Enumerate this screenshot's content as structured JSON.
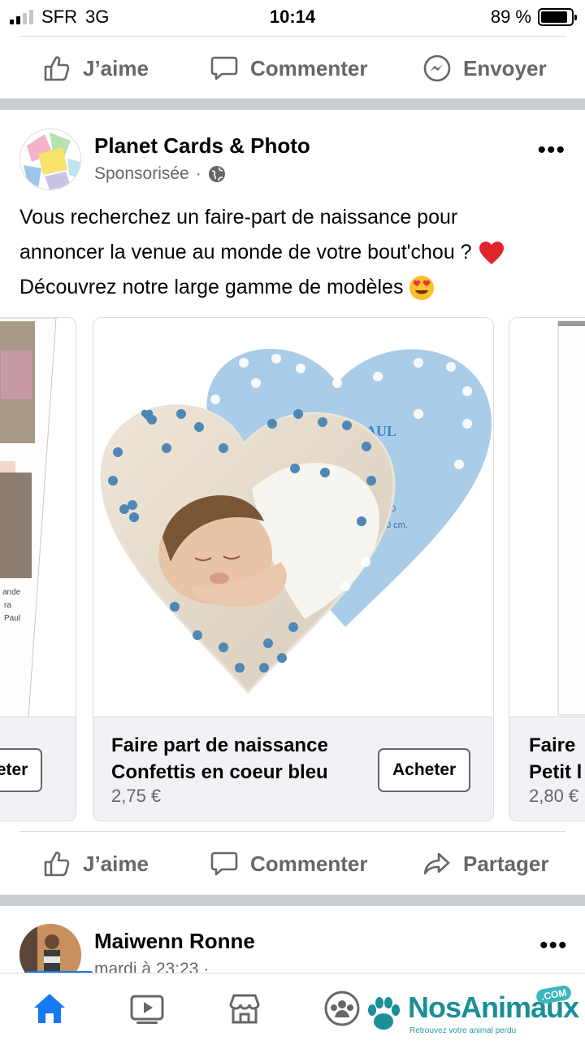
{
  "status_bar": {
    "carrier": "SFR",
    "network": "3G",
    "time": "10:14",
    "battery": "89 %",
    "battery_level": 0.89
  },
  "top_actions": {
    "like": "J’aime",
    "comment": "Commenter",
    "send": "Envoyer"
  },
  "post": {
    "page_name": "Planet Cards & Photo",
    "sponsored": "Sponsorisée",
    "more": "•••",
    "text_lines": [
      "Vous recherchez un faire-part de naissance pour",
      "annoncer la venue au monde de votre bout'chou ?",
      "Découvrez notre large gamme de modèles"
    ],
    "carousel": [
      {
        "title": "",
        "price": "",
        "button": "heter"
      },
      {
        "title_line1": "Faire part de naissance",
        "title_line2": "Confettis en coeur bleu",
        "price": "2,75 €",
        "button": "Acheter"
      },
      {
        "title_line1": "Faire",
        "title_line2": "Petit l",
        "price": "2,80 €"
      }
    ],
    "actions": {
      "like": "J’aime",
      "comment": "Commenter",
      "share": "Partager"
    }
  },
  "next_post": {
    "author": "Maiwenn Ronne",
    "meta": "mardi à 23:23 ·"
  },
  "watermark": {
    "brand": "NosAnimaux",
    "tagline": "Retrouvez votre animal perdu",
    "com": ".COM"
  },
  "colors": {
    "accent": "#1877f2",
    "secondary_text": "#65676b",
    "separator": "#c9ccd1",
    "card_blue": "#a9cde8"
  }
}
